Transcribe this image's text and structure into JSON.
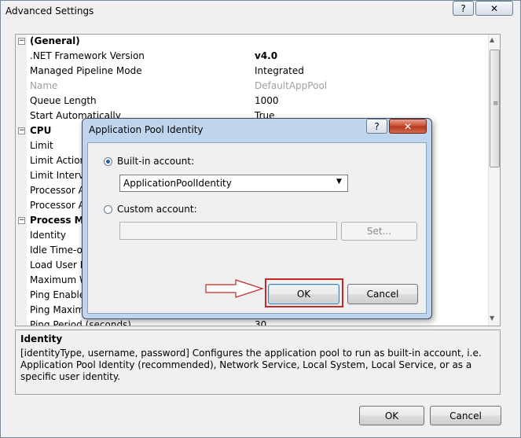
{
  "window": {
    "title": "Advanced Settings",
    "help_glyph": "?",
    "close_glyph": "✕",
    "ok_label": "OK",
    "cancel_label": "Cancel"
  },
  "grid": {
    "toggle_glyph": "−",
    "rows": [
      {
        "type": "category",
        "label": "(General)",
        "value": ""
      },
      {
        "type": "prop",
        "label": ".NET Framework Version",
        "value": "v4.0",
        "bold": true
      },
      {
        "type": "prop",
        "label": "Managed Pipeline Mode",
        "value": "Integrated"
      },
      {
        "type": "prop",
        "label": "Name",
        "value": "DefaultAppPool",
        "disabled": true
      },
      {
        "type": "prop",
        "label": "Queue Length",
        "value": "1000"
      },
      {
        "type": "prop",
        "label": "Start Automatically",
        "value": "True"
      },
      {
        "type": "category",
        "label": "CPU",
        "value": ""
      },
      {
        "type": "prop",
        "label": "Limit",
        "value": ""
      },
      {
        "type": "prop",
        "label": "Limit Action",
        "value": ""
      },
      {
        "type": "prop",
        "label": "Limit Interva",
        "value": ""
      },
      {
        "type": "prop",
        "label": "Processor Af",
        "value": ""
      },
      {
        "type": "prop",
        "label": "Processor Af",
        "value": ""
      },
      {
        "type": "category",
        "label": "Process Mod",
        "value": ""
      },
      {
        "type": "prop",
        "label": "Identity",
        "value": ""
      },
      {
        "type": "prop",
        "label": "Idle Time-ou",
        "value": ""
      },
      {
        "type": "prop",
        "label": "Load User Pr",
        "value": ""
      },
      {
        "type": "prop",
        "label": "Maximum W",
        "value": ""
      },
      {
        "type": "prop",
        "label": "Ping Enabled",
        "value": ""
      },
      {
        "type": "prop",
        "label": "Ping Maximu",
        "value": ""
      },
      {
        "type": "prop",
        "label": "Ping Period (seconds)",
        "value": "30"
      }
    ],
    "scroll_up_glyph": "▲",
    "scroll_down_glyph": "▼",
    "scroll_grip": "≡"
  },
  "description": {
    "title": "Identity",
    "text": "[identityType, username, password] Configures the application pool to run as built-in account, i.e. Application Pool Identity (recommended), Network Service, Local System, Local Service, or as a specific user identity."
  },
  "dialog": {
    "title": "Application Pool Identity",
    "help_glyph": "?",
    "close_glyph": "✕",
    "builtin_label": "Built-in account:",
    "builtin_selected": true,
    "builtin_value": "ApplicationPoolIdentity",
    "dropdown_glyph": "▼",
    "custom_label": "Custom account:",
    "custom_value": "",
    "set_label": "Set...",
    "ok_label": "OK",
    "cancel_label": "Cancel"
  },
  "colors": {
    "annotation_red": "#c62828",
    "dialog_frame": "#bfd5ee",
    "close_red": "#c44b2d"
  }
}
